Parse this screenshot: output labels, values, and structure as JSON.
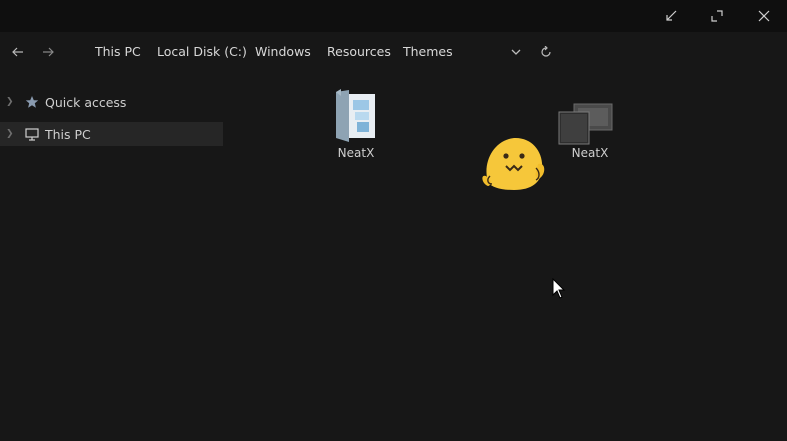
{
  "breadcrumbs": [
    "This PC",
    "Local Disk (C:)",
    "Windows",
    "Resources",
    "Themes"
  ],
  "sidebar": {
    "items": [
      {
        "label": "Quick access",
        "icon": "star-icon"
      },
      {
        "label": "This PC",
        "icon": "monitor-icon",
        "selected": true
      }
    ]
  },
  "files": [
    {
      "label": "NeatX",
      "icon": "folder-with-images-icon"
    },
    {
      "label": "NeatX",
      "icon": "theme-file-icon"
    }
  ],
  "window_controls": [
    "restore-down-icon",
    "maximize-icon",
    "close-icon"
  ],
  "colors": {
    "background": "#171717",
    "titlebar": "#0f0f0f",
    "selected": "#262626",
    "text": "#d6d6d6"
  }
}
